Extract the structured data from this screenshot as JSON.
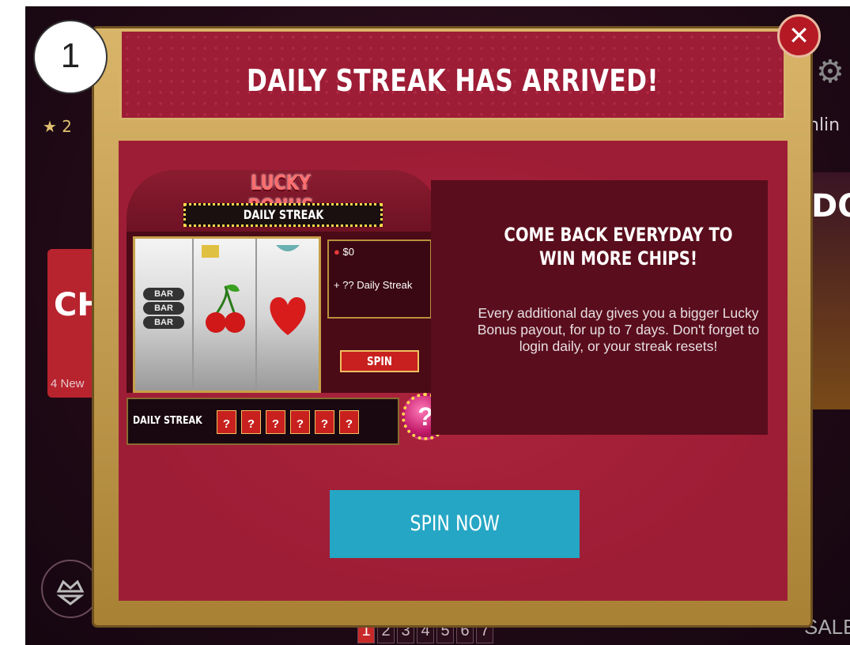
{
  "badge": {
    "number": "1"
  },
  "background": {
    "stars": "★ 2",
    "left_card_title": "CH",
    "left_card_sub": "4 New",
    "right_card_title": "DOT",
    "online": "nlin",
    "pages": [
      "1",
      "2",
      "3",
      "4",
      "5",
      "6",
      "7"
    ],
    "sale": "SALE"
  },
  "modal": {
    "title": "DAILY STREAK HAS ARRIVED!",
    "close_icon": "close-x",
    "headline": "COME BACK EVERYDAY TO WIN MORE CHIPS!",
    "description": "Every additional day gives you a bigger Lucky Bonus payout, for up to 7 days. Don't forget to login daily, or your streak resets!",
    "cta_label": "SPIN NOW"
  },
  "slot_machine": {
    "logo": "LUCKY BONUS",
    "marquee": "DAILY STREAK",
    "chip_amount": "$0",
    "bonus_line": "+ ?? Daily Streak",
    "spin_label": "SPIN",
    "bar_label": "BAR",
    "streak_label": "DAILY STREAK",
    "streak_days": [
      "?",
      "?",
      "?",
      "?",
      "?",
      "?"
    ],
    "bonus_bulb": "?"
  },
  "colors": {
    "accent": "#25a6c4",
    "panel": "#9e1d36",
    "frame": "#c9a553"
  }
}
